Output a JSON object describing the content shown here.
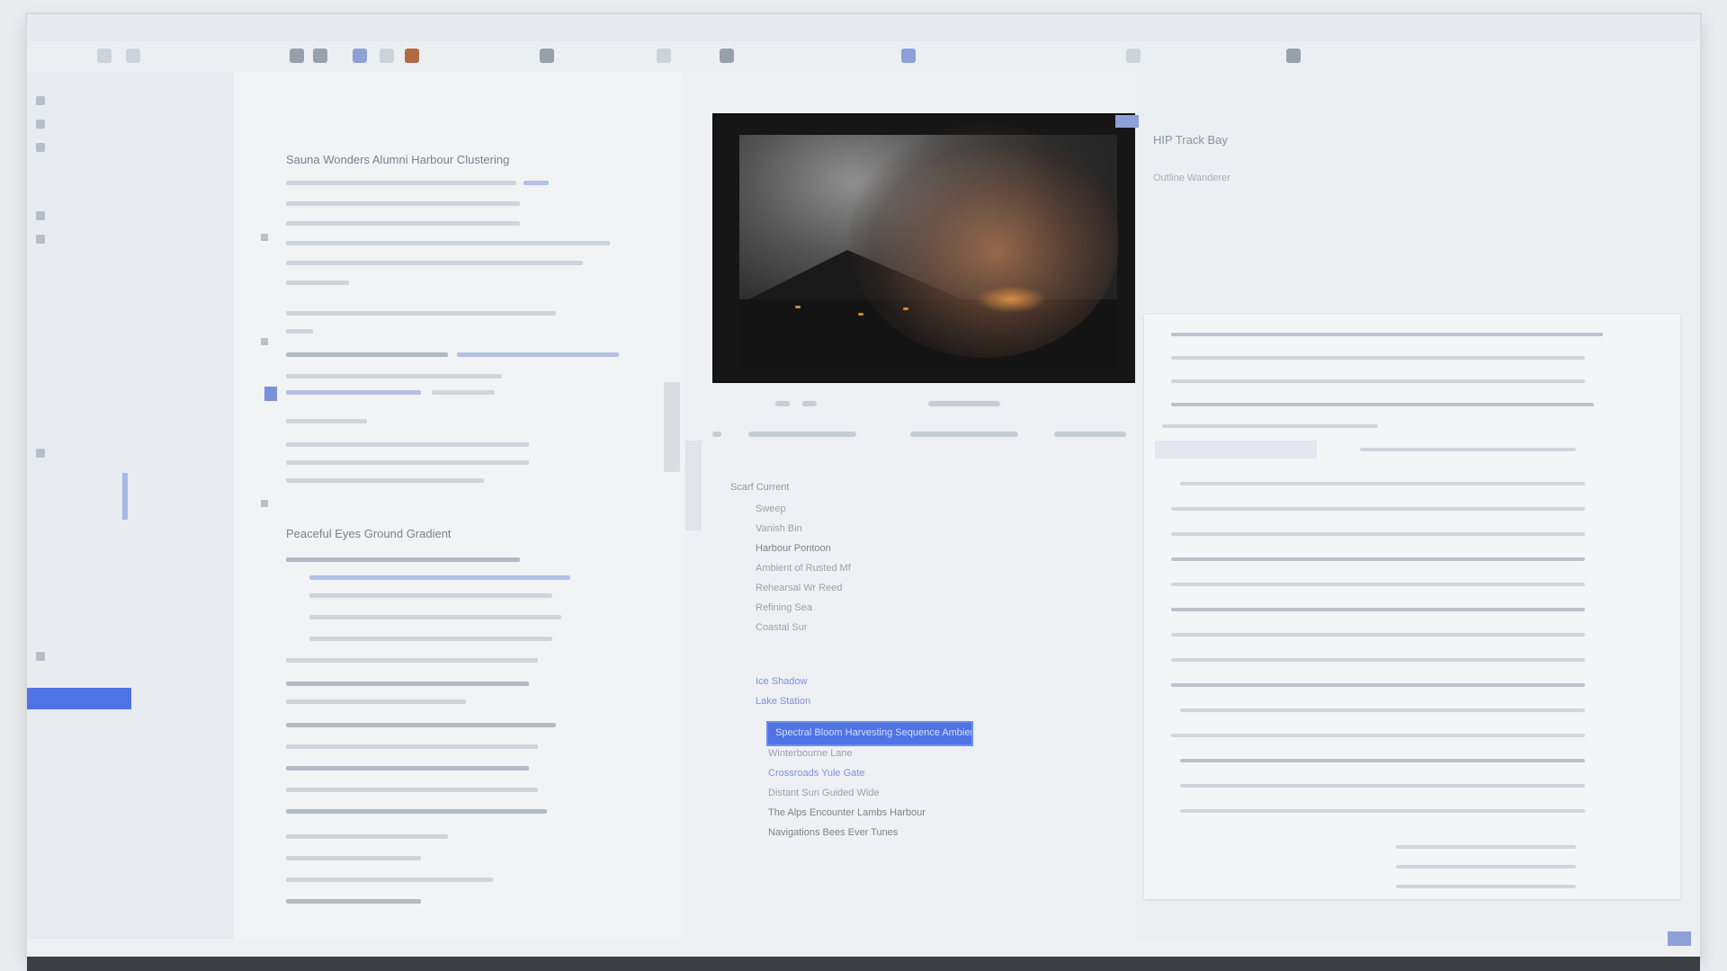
{
  "doc": {
    "heading": "Sauna Wonders Alumni Harbour Clustering",
    "section": "Peaceful Eyes Ground Gradient"
  },
  "viewer": {
    "list_title": "Scarf Current",
    "list": [
      "Sweep",
      "Vanish Bin",
      "Harbour Pontoon",
      "Ambient of Rusted Mf",
      "Rehearsal Wr Reed",
      "Refining Sea",
      "Coastal Sur"
    ],
    "blue_items": [
      "Ice Shadow",
      "Lake Station"
    ],
    "selected_item": "Spectral Bloom Harvesting Sequence Ambient",
    "after_items": [
      "Winterbourne Lane",
      "Crossroads Yule Gate",
      "Distant Sun Guided Wide",
      "The Alps Encounter Lambs Harbour",
      "Navigations Bees Ever Tunes"
    ]
  },
  "right": {
    "title": "HIP Track Bay",
    "subtitle": "Outline Wanderer"
  }
}
